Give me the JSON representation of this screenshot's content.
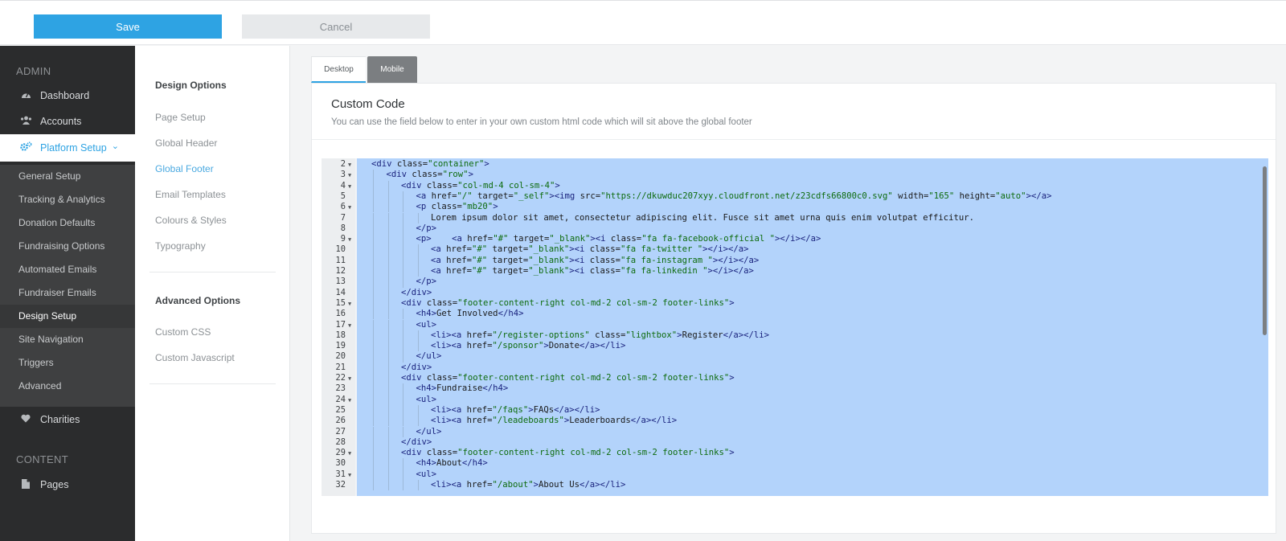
{
  "toolbar": {
    "save_label": "Save",
    "cancel_label": "Cancel"
  },
  "sidebar": {
    "admin_title": "ADMIN",
    "content_title": "CONTENT",
    "items": [
      {
        "label": "Dashboard",
        "icon": "dashboard-icon"
      },
      {
        "label": "Accounts",
        "icon": "users-icon"
      },
      {
        "label": "Platform Setup",
        "icon": "cogs-icon",
        "chevron": "⌄"
      },
      {
        "label": "Charities",
        "icon": "heart-icon"
      },
      {
        "label": "Pages",
        "icon": "file-icon"
      }
    ],
    "sub_items": [
      "General Setup",
      "Tracking & Analytics",
      "Donation Defaults",
      "Fundraising Options",
      "Automated Emails",
      "Fundraiser Emails",
      "Design Setup",
      "Site Navigation",
      "Triggers",
      "Advanced"
    ]
  },
  "submenu": {
    "design_title": "Design Options",
    "design_items": [
      "Page Setup",
      "Global Header",
      "Global Footer",
      "Email Templates",
      "Colours & Styles",
      "Typography"
    ],
    "advanced_title": "Advanced Options",
    "advanced_items": [
      "Custom CSS",
      "Custom Javascript"
    ]
  },
  "tabs": {
    "desktop": "Desktop",
    "mobile": "Mobile"
  },
  "card": {
    "title": "Custom Code",
    "description": "You can use the field below to enter in your own custom html code which will sit above the global footer"
  },
  "code_lines": [
    {
      "n": "2",
      "fold": true,
      "indent": 0,
      "tokens": [
        [
          "tg",
          "<div "
        ],
        [
          "at",
          "class="
        ],
        [
          "st",
          "\"container\""
        ],
        [
          "tg",
          ">"
        ]
      ]
    },
    {
      "n": "3",
      "fold": true,
      "indent": 1,
      "tokens": [
        [
          "tg",
          "<div "
        ],
        [
          "at",
          "class="
        ],
        [
          "st",
          "\"row\""
        ],
        [
          "tg",
          ">"
        ]
      ]
    },
    {
      "n": "4",
      "fold": true,
      "indent": 2,
      "tokens": [
        [
          "tg",
          "<div "
        ],
        [
          "at",
          "class="
        ],
        [
          "st",
          "\"col-md-4 col-sm-4\""
        ],
        [
          "tg",
          ">"
        ]
      ]
    },
    {
      "n": "5",
      "fold": false,
      "indent": 3,
      "tokens": [
        [
          "tg",
          "<a "
        ],
        [
          "at",
          "href="
        ],
        [
          "st",
          "\"/\""
        ],
        [
          "at",
          " target="
        ],
        [
          "st",
          "\"_self\""
        ],
        [
          "tg",
          "><img "
        ],
        [
          "at",
          "src="
        ],
        [
          "st",
          "\"https://dkuwduc207xyy.cloudfront.net/z23cdfs66800c0.svg\""
        ],
        [
          "at",
          " width="
        ],
        [
          "st",
          "\"165\""
        ],
        [
          "at",
          " height="
        ],
        [
          "st",
          "\"auto\""
        ],
        [
          "tg",
          "></a>"
        ]
      ]
    },
    {
      "n": "6",
      "fold": true,
      "indent": 3,
      "tokens": [
        [
          "tg",
          "<p "
        ],
        [
          "at",
          "class="
        ],
        [
          "st",
          "\"mb20\""
        ],
        [
          "tg",
          ">"
        ]
      ]
    },
    {
      "n": "7",
      "fold": false,
      "indent": 4,
      "tokens": [
        [
          "at",
          "Lorem ipsum dolor sit amet, consectetur adipiscing elit. Fusce sit amet urna quis enim volutpat efficitur."
        ]
      ]
    },
    {
      "n": "8",
      "fold": false,
      "indent": 3,
      "tokens": [
        [
          "tg",
          "</p>"
        ]
      ]
    },
    {
      "n": "9",
      "fold": true,
      "indent": 3,
      "tokens": [
        [
          "tg",
          "<p>"
        ],
        [
          "at",
          "    "
        ],
        [
          "tg",
          "<a "
        ],
        [
          "at",
          "href="
        ],
        [
          "st",
          "\"#\""
        ],
        [
          "at",
          " target="
        ],
        [
          "st",
          "\"_blank\""
        ],
        [
          "tg",
          "><i "
        ],
        [
          "at",
          "class="
        ],
        [
          "st",
          "\"fa fa-facebook-official \""
        ],
        [
          "tg",
          "></i></a>"
        ]
      ]
    },
    {
      "n": "10",
      "fold": false,
      "indent": 4,
      "tokens": [
        [
          "tg",
          "<a "
        ],
        [
          "at",
          "href="
        ],
        [
          "st",
          "\"#\""
        ],
        [
          "at",
          " target="
        ],
        [
          "st",
          "\"_blank\""
        ],
        [
          "tg",
          "><i "
        ],
        [
          "at",
          "class="
        ],
        [
          "st",
          "\"fa fa-twitter \""
        ],
        [
          "tg",
          "></i></a>"
        ]
      ]
    },
    {
      "n": "11",
      "fold": false,
      "indent": 4,
      "tokens": [
        [
          "tg",
          "<a "
        ],
        [
          "at",
          "href="
        ],
        [
          "st",
          "\"#\""
        ],
        [
          "at",
          " target="
        ],
        [
          "st",
          "\"_blank\""
        ],
        [
          "tg",
          "><i "
        ],
        [
          "at",
          "class="
        ],
        [
          "st",
          "\"fa fa-instagram \""
        ],
        [
          "tg",
          "></i></a>"
        ]
      ]
    },
    {
      "n": "12",
      "fold": false,
      "indent": 4,
      "tokens": [
        [
          "tg",
          "<a "
        ],
        [
          "at",
          "href="
        ],
        [
          "st",
          "\"#\""
        ],
        [
          "at",
          " target="
        ],
        [
          "st",
          "\"_blank\""
        ],
        [
          "tg",
          "><i "
        ],
        [
          "at",
          "class="
        ],
        [
          "st",
          "\"fa fa-linkedin \""
        ],
        [
          "tg",
          "></i></a>"
        ]
      ]
    },
    {
      "n": "13",
      "fold": false,
      "indent": 3,
      "tokens": [
        [
          "tg",
          "</p>"
        ]
      ]
    },
    {
      "n": "14",
      "fold": false,
      "indent": 2,
      "tokens": [
        [
          "tg",
          "</div>"
        ]
      ]
    },
    {
      "n": "15",
      "fold": true,
      "indent": 2,
      "tokens": [
        [
          "tg",
          "<div "
        ],
        [
          "at",
          "class="
        ],
        [
          "st",
          "\"footer-content-right col-md-2 col-sm-2 footer-links\""
        ],
        [
          "tg",
          ">"
        ]
      ]
    },
    {
      "n": "16",
      "fold": false,
      "indent": 3,
      "tokens": [
        [
          "tg",
          "<h4>"
        ],
        [
          "at",
          "Get Involved"
        ],
        [
          "tg",
          "</h4>"
        ]
      ]
    },
    {
      "n": "17",
      "fold": true,
      "indent": 3,
      "tokens": [
        [
          "tg",
          "<ul>"
        ]
      ]
    },
    {
      "n": "18",
      "fold": false,
      "indent": 4,
      "tokens": [
        [
          "tg",
          "<li><a "
        ],
        [
          "at",
          "href="
        ],
        [
          "st",
          "\"/register-options\""
        ],
        [
          "at",
          " class="
        ],
        [
          "st",
          "\"lightbox\""
        ],
        [
          "tg",
          ">"
        ],
        [
          "at",
          "Register"
        ],
        [
          "tg",
          "</a></li>"
        ]
      ]
    },
    {
      "n": "19",
      "fold": false,
      "indent": 4,
      "tokens": [
        [
          "tg",
          "<li><a "
        ],
        [
          "at",
          "href="
        ],
        [
          "st",
          "\"/sponsor\""
        ],
        [
          "tg",
          ">"
        ],
        [
          "at",
          "Donate"
        ],
        [
          "tg",
          "</a></li>"
        ]
      ]
    },
    {
      "n": "20",
      "fold": false,
      "indent": 3,
      "tokens": [
        [
          "tg",
          "</ul>"
        ]
      ]
    },
    {
      "n": "21",
      "fold": false,
      "indent": 2,
      "tokens": [
        [
          "tg",
          "</div>"
        ]
      ]
    },
    {
      "n": "22",
      "fold": true,
      "indent": 2,
      "tokens": [
        [
          "tg",
          "<div "
        ],
        [
          "at",
          "class="
        ],
        [
          "st",
          "\"footer-content-right col-md-2 col-sm-2 footer-links\""
        ],
        [
          "tg",
          ">"
        ]
      ]
    },
    {
      "n": "23",
      "fold": false,
      "indent": 3,
      "tokens": [
        [
          "tg",
          "<h4>"
        ],
        [
          "at",
          "Fundraise"
        ],
        [
          "tg",
          "</h4>"
        ]
      ]
    },
    {
      "n": "24",
      "fold": true,
      "indent": 3,
      "tokens": [
        [
          "tg",
          "<ul>"
        ]
      ]
    },
    {
      "n": "25",
      "fold": false,
      "indent": 4,
      "tokens": [
        [
          "tg",
          "<li><a "
        ],
        [
          "at",
          "href="
        ],
        [
          "st",
          "\"/faqs\""
        ],
        [
          "tg",
          ">"
        ],
        [
          "at",
          "FAQs"
        ],
        [
          "tg",
          "</a></li>"
        ]
      ]
    },
    {
      "n": "26",
      "fold": false,
      "indent": 4,
      "tokens": [
        [
          "tg",
          "<li><a "
        ],
        [
          "at",
          "href="
        ],
        [
          "st",
          "\"/leadeboards\""
        ],
        [
          "tg",
          ">"
        ],
        [
          "at",
          "Leaderboards"
        ],
        [
          "tg",
          "</a></li>"
        ]
      ]
    },
    {
      "n": "27",
      "fold": false,
      "indent": 3,
      "tokens": [
        [
          "tg",
          "</ul>"
        ]
      ]
    },
    {
      "n": "28",
      "fold": false,
      "indent": 2,
      "tokens": [
        [
          "tg",
          "</div>"
        ]
      ]
    },
    {
      "n": "29",
      "fold": true,
      "indent": 2,
      "tokens": [
        [
          "tg",
          "<div "
        ],
        [
          "at",
          "class="
        ],
        [
          "st",
          "\"footer-content-right col-md-2 col-sm-2 footer-links\""
        ],
        [
          "tg",
          ">"
        ]
      ]
    },
    {
      "n": "30",
      "fold": false,
      "indent": 3,
      "tokens": [
        [
          "tg",
          "<h4>"
        ],
        [
          "at",
          "About"
        ],
        [
          "tg",
          "</h4>"
        ]
      ]
    },
    {
      "n": "31",
      "fold": true,
      "indent": 3,
      "tokens": [
        [
          "tg",
          "<ul>"
        ]
      ]
    },
    {
      "n": "32",
      "fold": false,
      "indent": 4,
      "tokens": [
        [
          "tg",
          "<li><a "
        ],
        [
          "at",
          "href="
        ],
        [
          "st",
          "\"/about\""
        ],
        [
          "tg",
          ">"
        ],
        [
          "at",
          "About Us"
        ],
        [
          "tg",
          "</a></li>"
        ]
      ]
    }
  ],
  "colors": {
    "accent": "#2ea3e3",
    "sidebar_bg": "#2b2c2d",
    "selection": "#b3d3fb"
  }
}
